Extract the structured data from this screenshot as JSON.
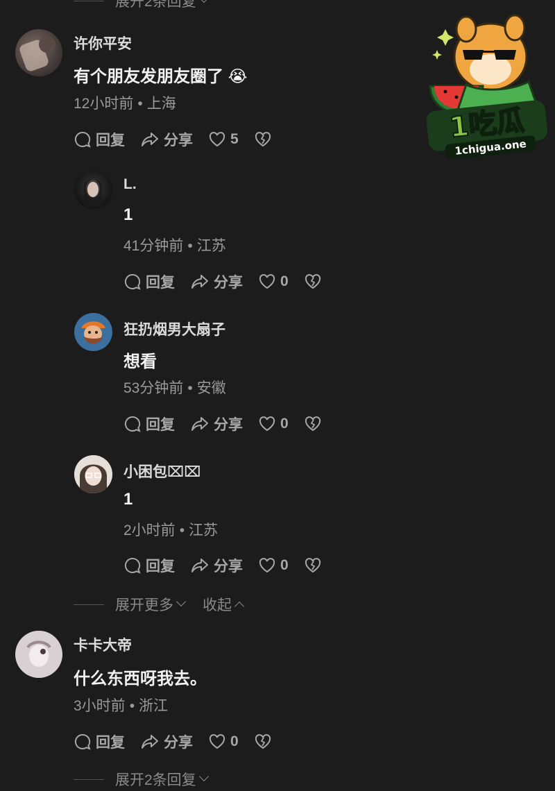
{
  "top_expand": {
    "label": "展开2条回复"
  },
  "comments": [
    {
      "name": "许你平安",
      "text": "有个朋友发朋友圈了",
      "emoji": "😭",
      "time": "12小时前",
      "location": "上海",
      "reply_label": "回复",
      "share_label": "分享",
      "likes": "5"
    },
    {
      "name": "L.",
      "text": "1",
      "time": "41分钟前",
      "location": "江苏",
      "reply_label": "回复",
      "share_label": "分享",
      "likes": "0"
    },
    {
      "name": "狂扔烟男大扇子",
      "text": "想看",
      "time": "53分钟前",
      "location": "安徽",
      "reply_label": "回复",
      "share_label": "分享",
      "likes": "0"
    },
    {
      "name": "小困包⌧⌧",
      "text": "1",
      "time": "2小时前",
      "location": "江苏",
      "reply_label": "回复",
      "share_label": "分享",
      "likes": "0"
    },
    {
      "name": "卡卡大帝",
      "text": "什么东西呀我去。",
      "time": "3小时前",
      "location": "浙江",
      "reply_label": "回复",
      "share_label": "分享",
      "likes": "0"
    }
  ],
  "expand_more": {
    "label": "展开更多",
    "collapse_label": "收起"
  },
  "bottom_expand": {
    "label": "展开2条回复"
  },
  "watermark": {
    "text": "1吃瓜",
    "url": "1chigua.one"
  },
  "colors": {
    "background": "#1c1c1c",
    "text": "#f2f2f2",
    "meta": "#9a9a9a",
    "logo_green": "#2e7d32"
  }
}
